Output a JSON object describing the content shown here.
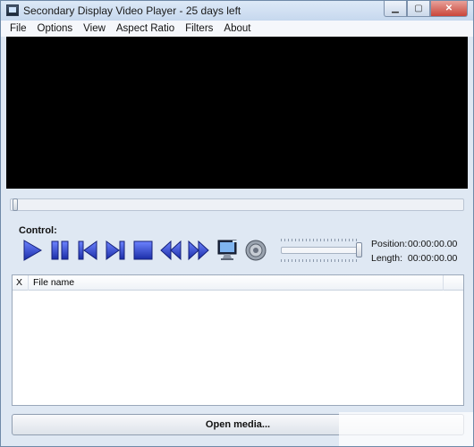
{
  "window": {
    "title": "Secondary Display Video Player - 25 days left",
    "minimize_glyph": "▁",
    "maximize_glyph": "▢",
    "close_glyph": "✕"
  },
  "menu": [
    {
      "label": "File"
    },
    {
      "label": "Options"
    },
    {
      "label": "View"
    },
    {
      "label": "Aspect Ratio"
    },
    {
      "label": "Filters"
    },
    {
      "label": "About"
    }
  ],
  "seek": {
    "position_fraction": 0.0
  },
  "controls": {
    "label": "Control:",
    "buttons": [
      {
        "name": "play",
        "icon": "play-icon"
      },
      {
        "name": "pause",
        "icon": "pause-icon"
      },
      {
        "name": "previous",
        "icon": "previous-icon"
      },
      {
        "name": "next",
        "icon": "next-icon"
      },
      {
        "name": "stop",
        "icon": "stop-icon"
      },
      {
        "name": "rewind",
        "icon": "rewind-icon"
      },
      {
        "name": "fast-forward",
        "icon": "fast-forward-icon"
      },
      {
        "name": "secondary-display",
        "icon": "monitor-icon"
      },
      {
        "name": "volume",
        "icon": "speaker-icon"
      }
    ],
    "volume_level": 1.0,
    "position_label": "Position:",
    "position_value": "00:00:00.00",
    "length_label": "Length:",
    "length_value": "00:00:00.00"
  },
  "file_list": {
    "columns": [
      "X",
      "File name"
    ],
    "rows": []
  },
  "open_media_label": "Open media...",
  "colors": {
    "accent_blue": "#2a3fbf",
    "video_background": "#000000"
  }
}
